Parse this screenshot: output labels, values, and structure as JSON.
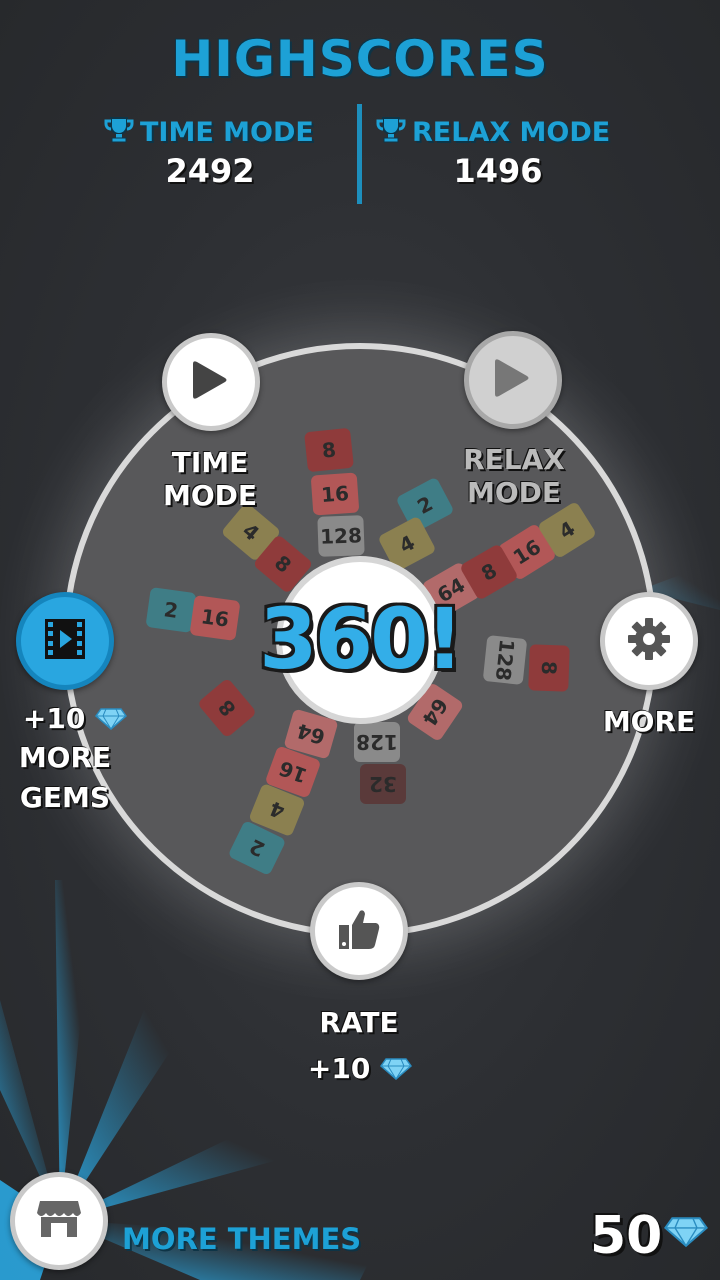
{
  "header": {
    "title": "HIGHSCORES"
  },
  "scores": {
    "time_mode_label": "TIME MODE",
    "time_mode_value": "2492",
    "relax_mode_label": "RELAX MODE",
    "relax_mode_value": "1496"
  },
  "wheel": {
    "logo": "360!",
    "time_mode": "TIME MODE",
    "relax_mode": "RELAX MODE",
    "more": "MORE",
    "gems_bonus": "+10",
    "more_gems_line1": "MORE",
    "more_gems_line2": "GEMS",
    "rate": "RATE",
    "rate_bonus": "+10"
  },
  "tiles": [
    "8",
    "16",
    "128",
    "2",
    "4",
    "4",
    "8",
    "16",
    "4",
    "64",
    "8",
    "2",
    "16",
    "128",
    "8",
    "64",
    "128",
    "32",
    "64",
    "16",
    "4",
    "2",
    "8"
  ],
  "footer": {
    "more_themes": "MORE THEMES",
    "gem_count": "50"
  },
  "colors": {
    "accent": "#1da1d6",
    "background": "#2b2d31"
  }
}
